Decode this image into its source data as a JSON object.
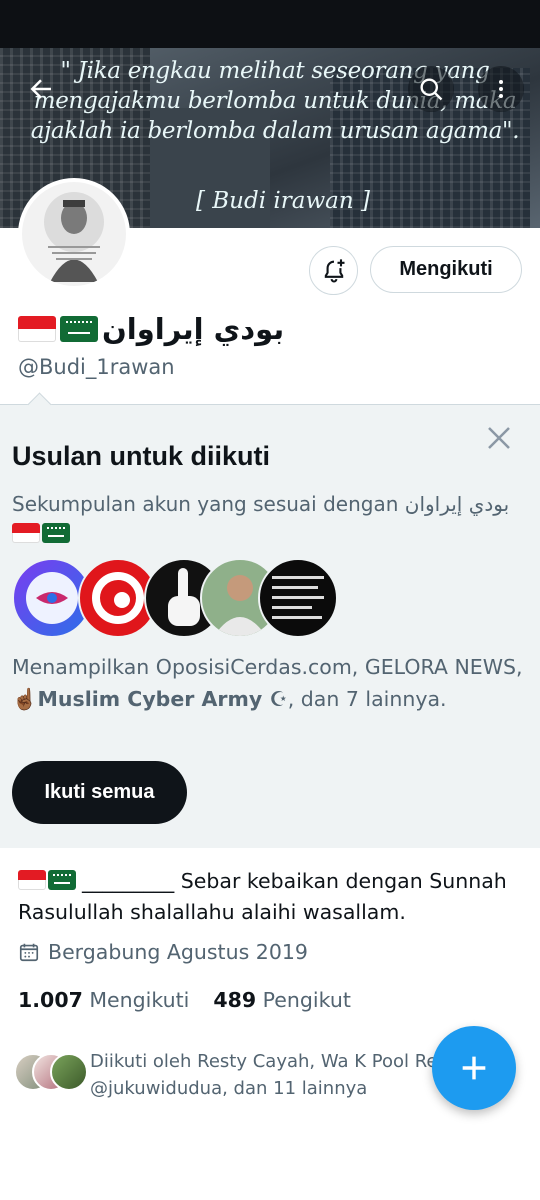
{
  "banner": {
    "quote": "\" Jika engkau melihat seseorang yang mengajakmu berlomba untuk dunia, maka ajaklah ia berlomba dalam urusan agama\".",
    "quote_author": "[ Budi irawan ]"
  },
  "header": {
    "back_icon": "arrow-left-icon",
    "search_icon": "search-icon",
    "more_icon": "more-vertical-icon"
  },
  "profile": {
    "display_name": "بودي إيراوان",
    "handle": "@Budi_1rawan",
    "follow_button": "Mengikuti",
    "bell_icon": "bell-plus-icon",
    "bio_text": "_________  Sebar kebaikan dengan Sunnah Rasulullah shalallahu alaihi wasallam.",
    "joined": "Bergabung Agustus 2019",
    "following_count": "1.007",
    "following_label": "Mengikuti",
    "followers_count": "489",
    "followers_label": "Pengikut",
    "followed_by_line1": "Diikuti oleh Resty Cayah, Wa K Pool Re",
    "followed_by_line2": "@jukuwidudua, dan 11 lainnya"
  },
  "suggestions": {
    "title": "Usulan untuk diikuti",
    "description": "Sekumpulan akun yang sesuai dengan بودي إيراوان",
    "shown_prefix": "Menampilkan OposisiCerdas.com, GELORA NEWS, ",
    "shown_bold": "☝🏾Muslim Cyber Army ☪",
    "shown_suffix": ", dan 7 lainnya.",
    "follow_all_button": "Ikuti semua",
    "close_icon": "close-icon"
  },
  "fab": {
    "icon": "plus-icon"
  },
  "colors": {
    "accent": "#1d9bf0",
    "text_primary": "#0f1419",
    "text_secondary": "#536471",
    "suggest_bg": "#eff3f4"
  }
}
